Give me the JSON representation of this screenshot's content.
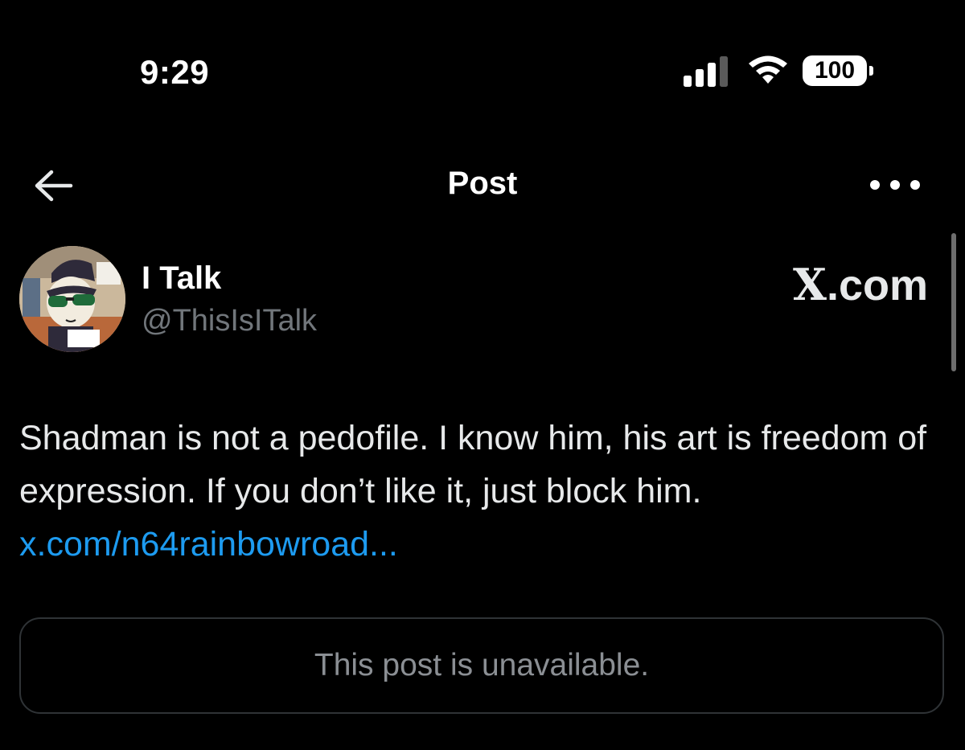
{
  "status_bar": {
    "time": "9:29",
    "battery": "100",
    "icons": [
      "cellular-signal-icon",
      "wifi-icon",
      "battery-icon"
    ]
  },
  "header": {
    "title": "Post",
    "back_icon": "arrow-left-icon",
    "more_icon": "more-horizontal-icon"
  },
  "author": {
    "display_name": "I Talk",
    "handle": "@ThisIsITalk",
    "avatar": "cartoon-avatar-sunglasses"
  },
  "watermark": {
    "x_letter": "X",
    "suffix": ".com"
  },
  "post": {
    "text": "Shadman is not a pedofile. I know him, his art is freedom of expression. If you don’t like it, just block him. ",
    "link": "x.com/n64rainbowroad..."
  },
  "quoted_post": {
    "message": "This post is unavailable."
  },
  "colors": {
    "background": "#000000",
    "primary_text": "#e7e9ea",
    "secondary_text": "#71767b",
    "link": "#1d9bf0",
    "border": "#2f3336"
  }
}
